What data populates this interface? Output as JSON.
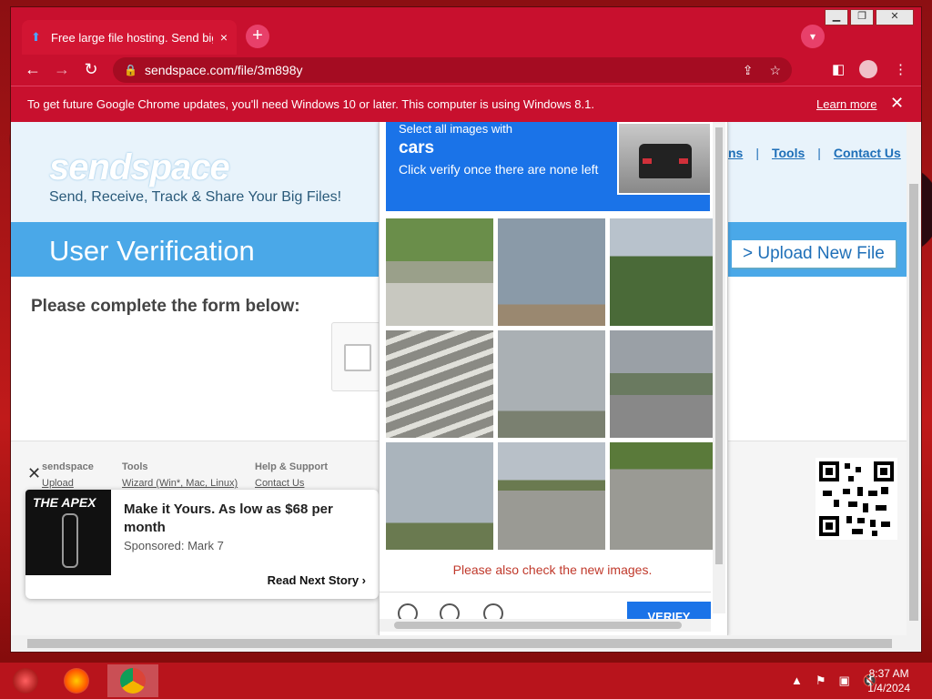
{
  "browser": {
    "tab_title": "Free large file hosting. Send big f",
    "tab_close": "×",
    "new_tab": "+",
    "url": "sendspace.com/file/3m898y",
    "back": "←",
    "forward": "→",
    "reload": "↻",
    "menu": "⋮"
  },
  "infobar": {
    "message": "To get future Google Chrome updates, you'll need Windows 10 or later. This computer is using Windows 8.1.",
    "learn_more": "Learn more",
    "close": "✕"
  },
  "site": {
    "logo": "sendspace",
    "tagline": "Send, Receive, Track & Share Your Big Files!",
    "page_heading": "User Verification",
    "nav": [
      "ns",
      "Tools",
      "Contact Us"
    ],
    "upload_button": "> Upload New File",
    "prompt": "Please complete the form below:"
  },
  "footer": {
    "cols": [
      {
        "heading": "sendspace",
        "link": "Upload"
      },
      {
        "heading": "Tools",
        "link": "Wizard (Win*, Mac, Linux)"
      },
      {
        "heading": "Help & Support",
        "link": "Contact Us"
      }
    ]
  },
  "ad": {
    "close": "✕",
    "brand": "THE APEX",
    "title": "Make it Yours. As low as $68 per month",
    "sponsor": "Sponsored: Mark 7",
    "next": "Read Next Story ›"
  },
  "captcha": {
    "line1": "Select all images with",
    "target": "cars",
    "line3": "Click verify once there are none left",
    "warning": "Please also check the new images.",
    "verify": "VERIFY"
  },
  "taskbar": {
    "time": "8:37 AM",
    "date": "1/4/2024"
  },
  "colors": {
    "chrome_red": "#c8102e",
    "captcha_blue": "#1a73e8",
    "sendspace_blue": "#4aa8e8"
  }
}
